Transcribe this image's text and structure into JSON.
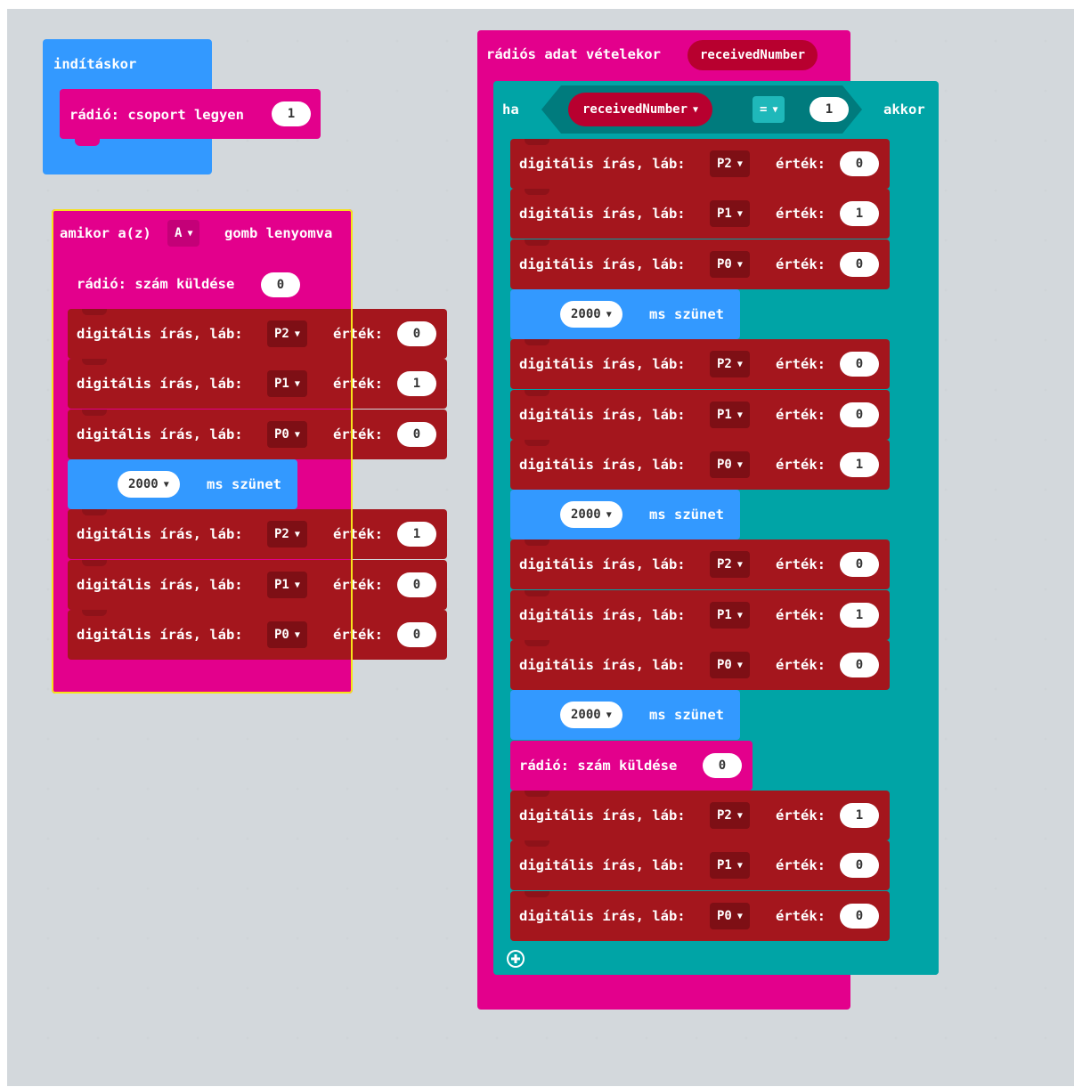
{
  "colors": {
    "event_blue": "#3399ff",
    "radio_pink": "#e3008c",
    "pins_red": "#a4161d",
    "logic_teal": "#00a4a6",
    "highlight_yellow": "#f7e21a",
    "workspace": "#eceff1"
  },
  "on_start": {
    "label": "indításkor",
    "set_group": {
      "label": "rádió: csoport legyen",
      "value": "1"
    }
  },
  "on_button": {
    "label_pre": "amikor a(z)",
    "button": "A",
    "label_post": "gomb lenyomva",
    "send": {
      "label": "rádió: szám küldése",
      "value": "0"
    },
    "steps": [
      {
        "type": "dw",
        "pin": "P2",
        "value": "0"
      },
      {
        "type": "dw",
        "pin": "P1",
        "value": "1"
      },
      {
        "type": "dw",
        "pin": "P0",
        "value": "0"
      },
      {
        "type": "pause",
        "ms": "2000"
      },
      {
        "type": "dw",
        "pin": "P2",
        "value": "1"
      },
      {
        "type": "dw",
        "pin": "P1",
        "value": "0"
      },
      {
        "type": "dw",
        "pin": "P0",
        "value": "0"
      }
    ]
  },
  "on_received": {
    "label": "rádiós adat vételekor",
    "var": "receivedNumber",
    "if_label": "ha",
    "cond_var": "receivedNumber",
    "cond_op": "=",
    "cond_value": "1",
    "then_label": "akkor",
    "add_icon": "plus-circle-icon",
    "send": {
      "label": "rádió: szám küldése",
      "value": "0"
    },
    "steps": [
      {
        "type": "dw",
        "pin": "P2",
        "value": "0"
      },
      {
        "type": "dw",
        "pin": "P1",
        "value": "1"
      },
      {
        "type": "dw",
        "pin": "P0",
        "value": "0"
      },
      {
        "type": "pause",
        "ms": "2000"
      },
      {
        "type": "dw",
        "pin": "P2",
        "value": "0"
      },
      {
        "type": "dw",
        "pin": "P1",
        "value": "0"
      },
      {
        "type": "dw",
        "pin": "P0",
        "value": "1"
      },
      {
        "type": "pause",
        "ms": "2000"
      },
      {
        "type": "dw",
        "pin": "P2",
        "value": "0"
      },
      {
        "type": "dw",
        "pin": "P1",
        "value": "1"
      },
      {
        "type": "dw",
        "pin": "P0",
        "value": "0"
      },
      {
        "type": "pause",
        "ms": "2000"
      },
      {
        "type": "send"
      },
      {
        "type": "dw",
        "pin": "P2",
        "value": "1"
      },
      {
        "type": "dw",
        "pin": "P1",
        "value": "0"
      },
      {
        "type": "dw",
        "pin": "P0",
        "value": "0"
      }
    ]
  },
  "labels": {
    "dw_prefix": "digitális írás, láb:",
    "dw_value": "érték:",
    "pause_suffix": "ms szünet"
  }
}
